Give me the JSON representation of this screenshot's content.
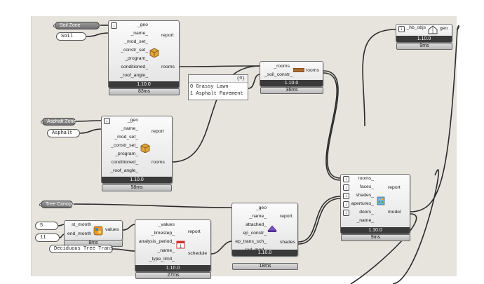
{
  "canvas": {
    "version": "1.10.0"
  },
  "soil_zone": {
    "label": "Soil Zone",
    "value": "Soil",
    "inputs": [
      "_geo",
      "_name_",
      "_mod_set_",
      "_constr_set_",
      "_program_",
      "conditioned_",
      "_roof_angle_"
    ],
    "outputs": [
      "report",
      "rooms"
    ],
    "version": "1.10.0",
    "time": "83ms"
  },
  "asphalt_zone": {
    "label": "Asphalt Zone",
    "value": "Asphalt",
    "inputs": [
      "_geo",
      "_name_",
      "_mod_set_",
      "_constr_set_",
      "_program_",
      "conditioned_",
      "_roof_angle_"
    ],
    "outputs": [
      "report",
      "rooms"
    ],
    "version": "1.10.0",
    "time": "58ms"
  },
  "constr_list": {
    "count": "{0}",
    "items": [
      "0 Grassy Lawn",
      "1 Asphalt Pavement"
    ]
  },
  "soil_constr": {
    "inputs": [
      "_rooms",
      "_soil_constr_"
    ],
    "outputs": [
      "rooms"
    ],
    "version": "1.10.0",
    "time": "36ms"
  },
  "hb_objs": {
    "inputs": [
      "_hb_objs"
    ],
    "outputs": [
      "geo"
    ],
    "version": "1.10.0",
    "time": "9ms"
  },
  "model": {
    "inputs": [
      "rooms_",
      "faces_",
      "shades_",
      "apertures_",
      "doors_",
      "_name_"
    ],
    "outputs": [
      "report",
      "model"
    ],
    "version": "1.10.0",
    "time": "9ms"
  },
  "tree_canopy": {
    "label": "Tree Canopy"
  },
  "month_inputs": {
    "st_month_value": "5",
    "end_month_value": "11",
    "inputs": [
      "st_month",
      "end_month"
    ],
    "outputs": [
      "values"
    ],
    "time": "8ms"
  },
  "deciduous": {
    "value": "Deciduous Tree Trans"
  },
  "schedule": {
    "inputs": [
      "_values",
      "_timestep_",
      "analysis_period_",
      "_name_",
      "_type_limit_"
    ],
    "outputs": [
      "report",
      "schedule"
    ],
    "version": "1.10.0",
    "time": "27ms"
  },
  "shades": {
    "inputs": [
      "_geo",
      "_name_",
      "attached_",
      "ep_constr_",
      "ep_trans_sch_",
      "rad_mod_"
    ],
    "outputs": [
      "report",
      "shades"
    ],
    "version": "1.10.0",
    "time": "18ms"
  }
}
